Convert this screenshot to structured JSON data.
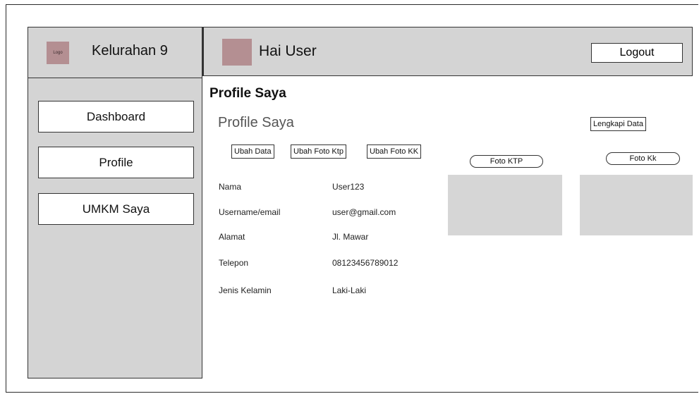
{
  "sidebar": {
    "logo_text": "Logo",
    "brand": "Kelurahan 9",
    "items": [
      {
        "label": "Dashboard"
      },
      {
        "label": "Profile"
      },
      {
        "label": "UMKM Saya"
      }
    ]
  },
  "header": {
    "greeting": "Hai User",
    "logout_label": "Logout"
  },
  "main": {
    "page_title": "Profile Saya",
    "section_title": "Profile Saya",
    "complete_data_label": "Lengkapi Data",
    "actions": [
      {
        "label": "Ubah Data"
      },
      {
        "label": "Ubah Foto Ktp"
      },
      {
        "label": "Ubah Foto KK"
      }
    ],
    "photos": [
      {
        "label": "Foto KTP"
      },
      {
        "label": "Foto Kk"
      }
    ],
    "fields": [
      {
        "label": "Nama",
        "value": "User123"
      },
      {
        "label": "Username/email",
        "value": "user@gmail.com"
      },
      {
        "label": "Alamat",
        "value": "Jl. Mawar"
      },
      {
        "label": "Telepon",
        "value": "08123456789012"
      },
      {
        "label": "Jenis Kelamin",
        "value": "Laki-Laki"
      }
    ]
  },
  "colors": {
    "panel": "#d4d4d4",
    "placeholder_image": "#b48f92",
    "photo_placeholder": "#d6d6d6"
  }
}
